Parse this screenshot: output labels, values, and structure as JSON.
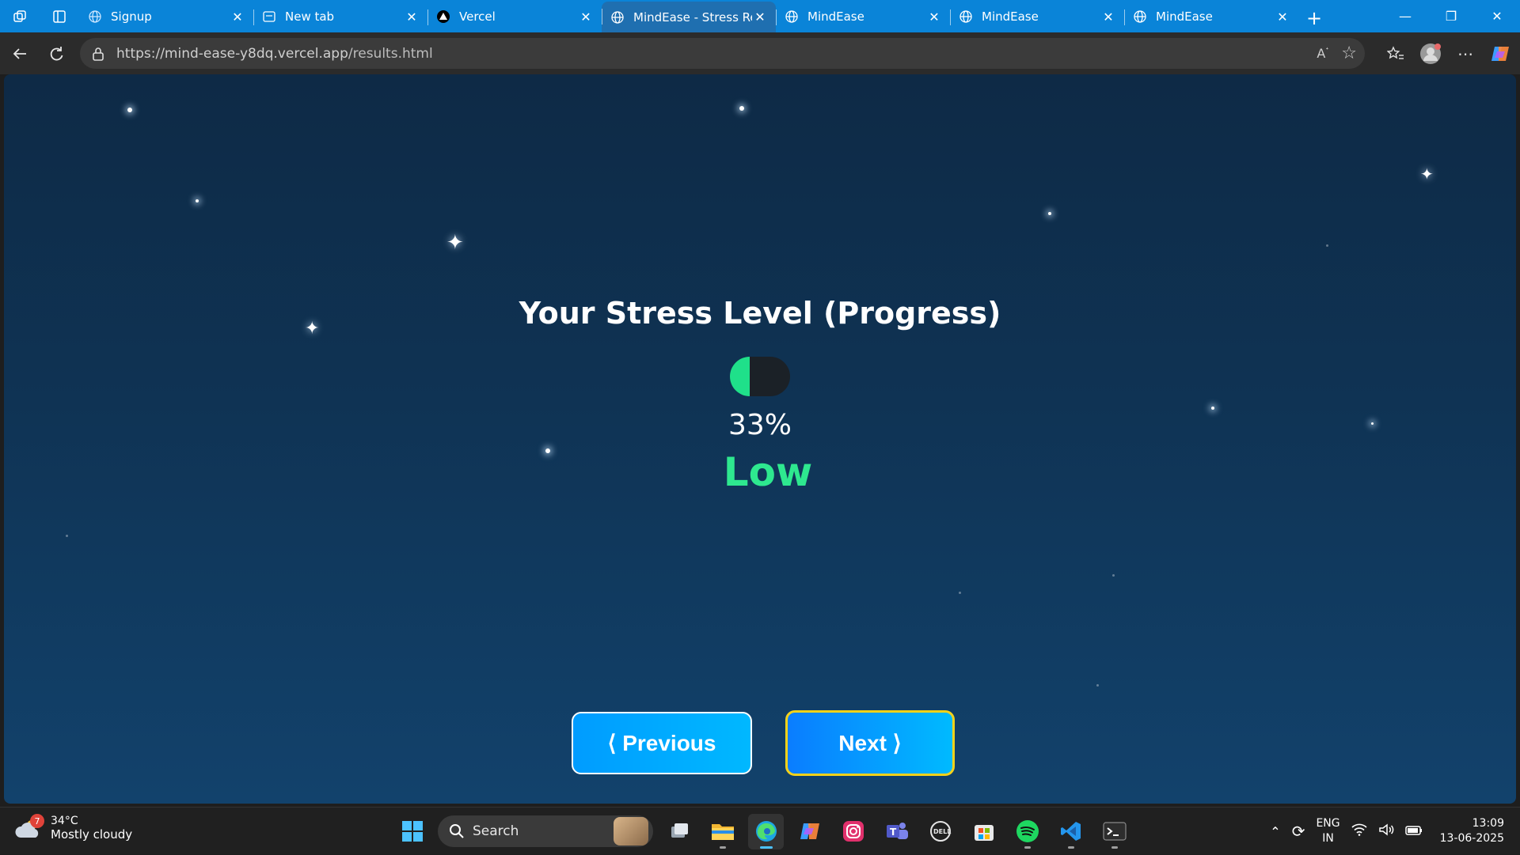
{
  "browser": {
    "tabs": [
      {
        "title": "Signup",
        "icon": "globe-icon",
        "active": false
      },
      {
        "title": "New tab",
        "icon": "newtab-icon",
        "active": false
      },
      {
        "title": "Vercel",
        "icon": "vercel-icon",
        "active": false
      },
      {
        "title": "MindEase - Stress Res",
        "icon": "globe-icon",
        "active": true
      },
      {
        "title": "MindEase",
        "icon": "globe-icon",
        "active": false
      },
      {
        "title": "MindEase",
        "icon": "globe-icon",
        "active": false
      },
      {
        "title": "MindEase",
        "icon": "globe-icon",
        "active": false
      }
    ],
    "url_host": "https://mind-ease-y8dq.vercel.app",
    "url_path": "/results.html"
  },
  "page": {
    "heading": "Your Stress Level (Progress)",
    "stress_percent": 33,
    "stress_percent_label": "33%",
    "stress_level": "Low",
    "meter_color": "#1fe08a",
    "level_color": "#2ee88f",
    "prev_label": "⟨ Previous",
    "next_label": "Next ⟩"
  },
  "taskbar": {
    "weather_badge": "7",
    "temperature": "34°C",
    "condition": "Mostly cloudy",
    "search_placeholder": "Search",
    "language_line1": "ENG",
    "language_line2": "IN",
    "time": "13:09",
    "date": "13-06-2025"
  },
  "colors": {
    "tabstrip": "#0a84d8",
    "button_gradient_start": "#009cff",
    "button_gradient_end": "#00b8ff",
    "next_border": "#f5d21a"
  }
}
